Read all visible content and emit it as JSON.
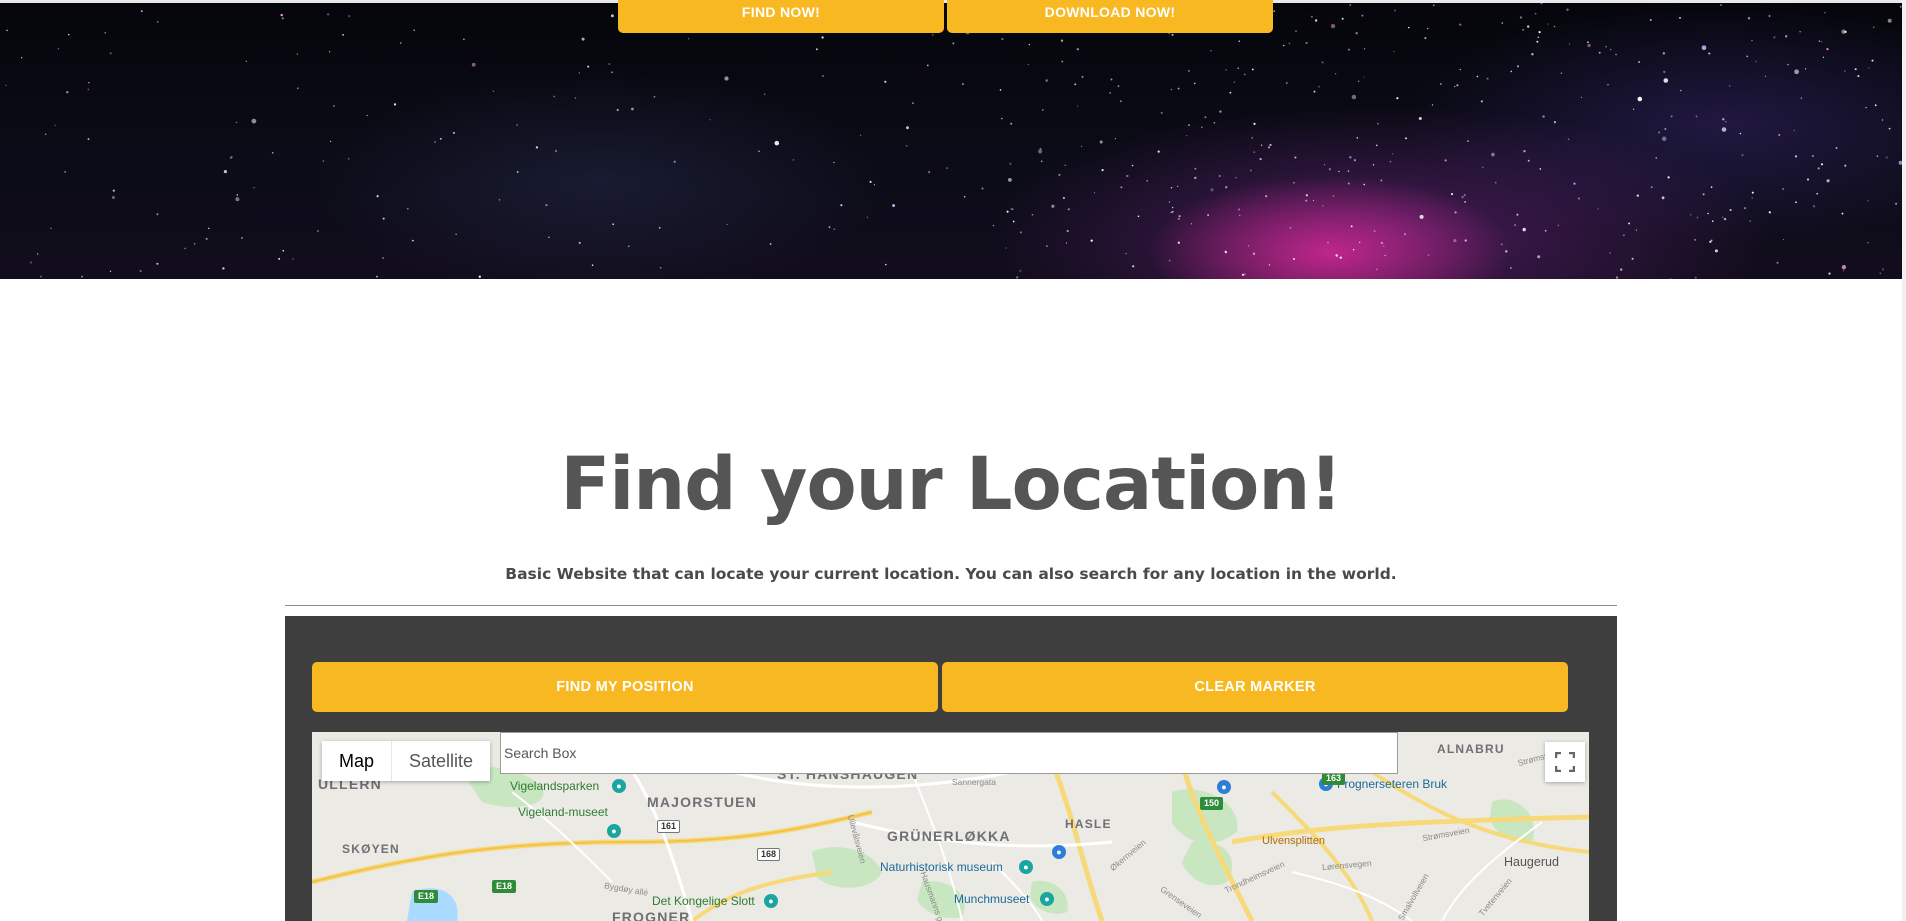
{
  "hero": {
    "find_now_label": "FIND NOW!",
    "download_now_label": "DOWNLOAD NOW!"
  },
  "section": {
    "title": "Find your Location!",
    "subtitle": "Basic Website that can locate your current location. You can also search for any location in the world."
  },
  "controls": {
    "find_position_label": "FIND MY POSITION",
    "clear_marker_label": "CLEAR MARKER"
  },
  "map": {
    "type_map_label": "Map",
    "type_satellite_label": "Satellite",
    "search_placeholder": "Search Box",
    "districts": [
      "ULLERN",
      "MAJORSTUEN",
      "ST. HANSHAUGEN",
      "GRÜNERLØKKA",
      "HASLE",
      "SKØYEN",
      "FROGNER",
      "ALNABRU"
    ],
    "pois": [
      "Vigelandsparken",
      "Vigeland-museet",
      "Naturhistorisk museum",
      "Munchmuseet",
      "Det Kongelige Slott",
      "Frognerseteren Bruk"
    ],
    "places": [
      "Ulvensplitten",
      "Haugerud"
    ],
    "streets": [
      "Sannergata",
      "Ullevålsveien",
      "Økernveien",
      "Strømsveien",
      "Bygdøy allé",
      "Grenseveien",
      "Smalvollveien",
      "Tvetenveien",
      "Strømsveien",
      "Hausmanns gate",
      "Trondheimsveien",
      "Lørensvegen"
    ],
    "road_shields": [
      "161",
      "168",
      "E18",
      "E18",
      "150",
      "163"
    ],
    "colors": {
      "accent": "#f8b822",
      "panel": "#3e3e3e",
      "title": "#555555"
    }
  }
}
